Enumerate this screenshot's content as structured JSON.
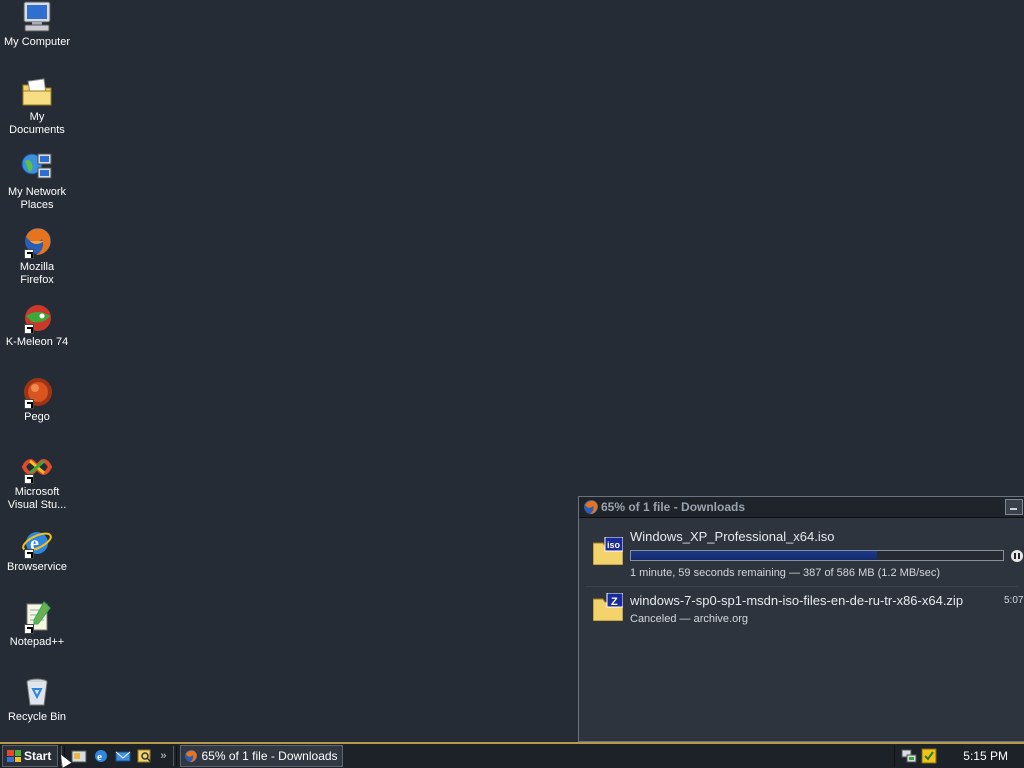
{
  "desktop": {
    "icons": [
      {
        "label": "My Computer",
        "icon": "computer-icon"
      },
      {
        "label": "My Documents",
        "icon": "folder-documents-icon"
      },
      {
        "label": "My Network Places",
        "icon": "network-icon"
      },
      {
        "label": "Mozilla Firefox",
        "icon": "firefox-icon"
      },
      {
        "label": "K-Meleon 74",
        "icon": "kmeleon-icon"
      },
      {
        "label": "Pego",
        "icon": "pego-icon"
      },
      {
        "label": "Microsoft Visual Stu...",
        "icon": "visual-studio-icon"
      },
      {
        "label": "Browservice",
        "icon": "internet-explorer-icon"
      },
      {
        "label": "Notepad++",
        "icon": "notepadpp-icon"
      },
      {
        "label": "Recycle Bin",
        "icon": "recycle-bin-icon"
      }
    ]
  },
  "downloads": {
    "title": "65% of 1 file - Downloads",
    "items": [
      {
        "name": "Windows_XP_Professional_x64.iso",
        "badge": "iso",
        "progress": 0.66,
        "status": "1 minute, 59 seconds remaining — 387 of 586 MB (1.2 MB/sec)"
      },
      {
        "name": "windows-7-sp0-sp1-msdn-iso-files-en-de-ru-tr-x86-x64.zip",
        "badge": "Z",
        "status": "Canceled — archive.org",
        "time": "5:07"
      }
    ]
  },
  "taskbar": {
    "start_label": "Start",
    "task_label": "65% of 1 file - Downloads",
    "clock": "5:15 PM",
    "chevron": "»"
  },
  "colors": {
    "desktop_bg": "#262c35",
    "taskbar_border": "#b59a4a",
    "progress_fill": "#1d3a8a"
  }
}
